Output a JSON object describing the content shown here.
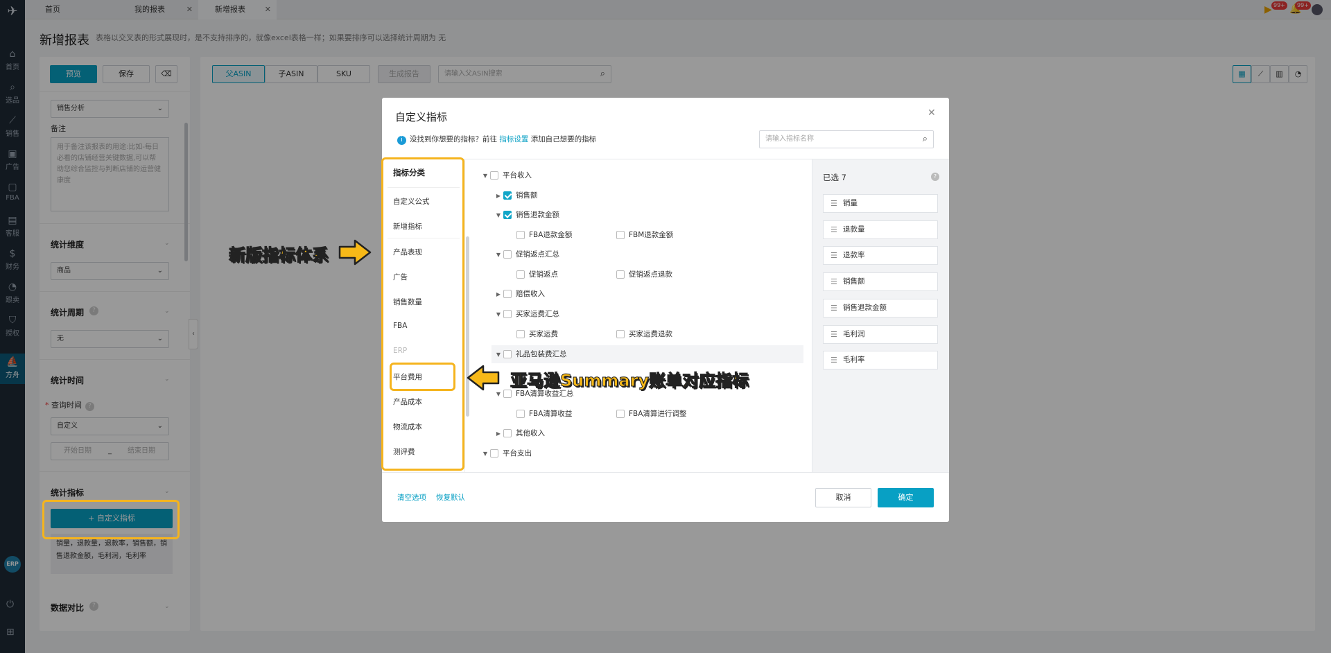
{
  "rail": {
    "items": [
      {
        "label": "首页",
        "icon": "home-icon"
      },
      {
        "label": "选品",
        "icon": "search-icon"
      },
      {
        "label": "销售",
        "icon": "chart-icon"
      },
      {
        "label": "广告",
        "icon": "ad-icon"
      },
      {
        "label": "FBA",
        "icon": "box-icon"
      },
      {
        "label": "客服",
        "icon": "message-icon"
      },
      {
        "label": "财务",
        "icon": "dollar-icon"
      },
      {
        "label": "跟卖",
        "icon": "pie-icon"
      },
      {
        "label": "授权",
        "icon": "shield-icon"
      },
      {
        "label": "方舟",
        "icon": "ark-icon"
      }
    ],
    "erp": "ERP"
  },
  "tabs": {
    "home": "首页",
    "my_reports": "我的报表",
    "new_report": "新增报表"
  },
  "notifications": {
    "badge1": "99+",
    "badge2": "99+"
  },
  "page": {
    "title": "新增报表",
    "subtitle": "表格以交叉表的形式展现时，是不支持排序的，就像excel表格一样；如果要排序可以选择统计周期为 无"
  },
  "left_panel": {
    "preview_label": "预览",
    "save_label": "保存",
    "template_value": "销售分析",
    "notes_label": "备注",
    "notes_placeholder": "用于备注该报表的用途:比如-每日必看的店铺经营关键数据,可以帮助您综合监控与判断店铺的运营健康度",
    "dimension_label": "统计维度",
    "dimension_value": "商品",
    "period_label": "统计周期",
    "period_value": "无",
    "time_label": "统计时间",
    "query_time_label": "查询时间",
    "query_time_value": "自定义",
    "start_date_placeholder": "开始日期",
    "date_separator": "_",
    "end_date_placeholder": "结束日期",
    "metrics_label": "统计指标",
    "custom_metrics_button": "+ 自定义指标",
    "selected_metrics_text": "销量，退款量，退款率，销售额，销售退款金额，毛利润，毛利率",
    "comparison_label": "数据对比"
  },
  "toolbar": {
    "parent_asin": "父ASIN",
    "child_asin": "子ASIN",
    "sku": "SKU",
    "generate_report": "生成报告",
    "search_placeholder": "请输入父ASIN搜索"
  },
  "modal": {
    "title": "自定义指标",
    "info_prefix": "没找到你想要的指标？前往",
    "info_link": "指标设置",
    "info_suffix": "添加自己想要的指标",
    "search_placeholder": "请输入指标名称",
    "category_header": "指标分类",
    "categories": [
      "自定义公式",
      "新增指标",
      "产品表现",
      "广告",
      "销售数量",
      "FBA",
      "ERP",
      "平台费用",
      "产品成本",
      "物流成本",
      "测评费"
    ],
    "tree": [
      {
        "label": "平台收入",
        "checked": false
      },
      {
        "label": "销售额",
        "checked": true
      },
      {
        "label": "销售退款金额",
        "checked": true
      },
      {
        "label": "FBA退款金额",
        "checked": false
      },
      {
        "label": "FBM退款金额",
        "checked": false
      },
      {
        "label": "促销返点汇总",
        "checked": false
      },
      {
        "label": "促销返点",
        "checked": false
      },
      {
        "label": "促销返点退款",
        "checked": false
      },
      {
        "label": "赔偿收入",
        "checked": false
      },
      {
        "label": "买家运费汇总",
        "checked": false
      },
      {
        "label": "买家运费",
        "checked": false
      },
      {
        "label": "买家运费退款",
        "checked": false
      },
      {
        "label": "礼品包装费汇总",
        "checked": false
      },
      {
        "label": "FBA清算收益汇总",
        "checked": false
      },
      {
        "label": "FBA清算收益",
        "checked": false
      },
      {
        "label": "FBA清算进行调整",
        "checked": false
      },
      {
        "label": "其他收入",
        "checked": false
      },
      {
        "label": "平台支出",
        "checked": false
      }
    ],
    "selected_title": "已选 7",
    "selected": [
      "销量",
      "退款量",
      "退款率",
      "销售额",
      "销售退款金额",
      "毛利润",
      "毛利率"
    ],
    "clear_label": "清空选项",
    "restore_label": "恢复默认",
    "cancel_label": "取消",
    "confirm_label": "确定"
  },
  "annotations": {
    "new_system": "新版指标体系",
    "amazon_summary": "亚马逊Summary账单对应指标"
  },
  "colors": {
    "accent": "#08a0c4",
    "highlight": "#f5b41e",
    "rail": "#1f2a36"
  }
}
